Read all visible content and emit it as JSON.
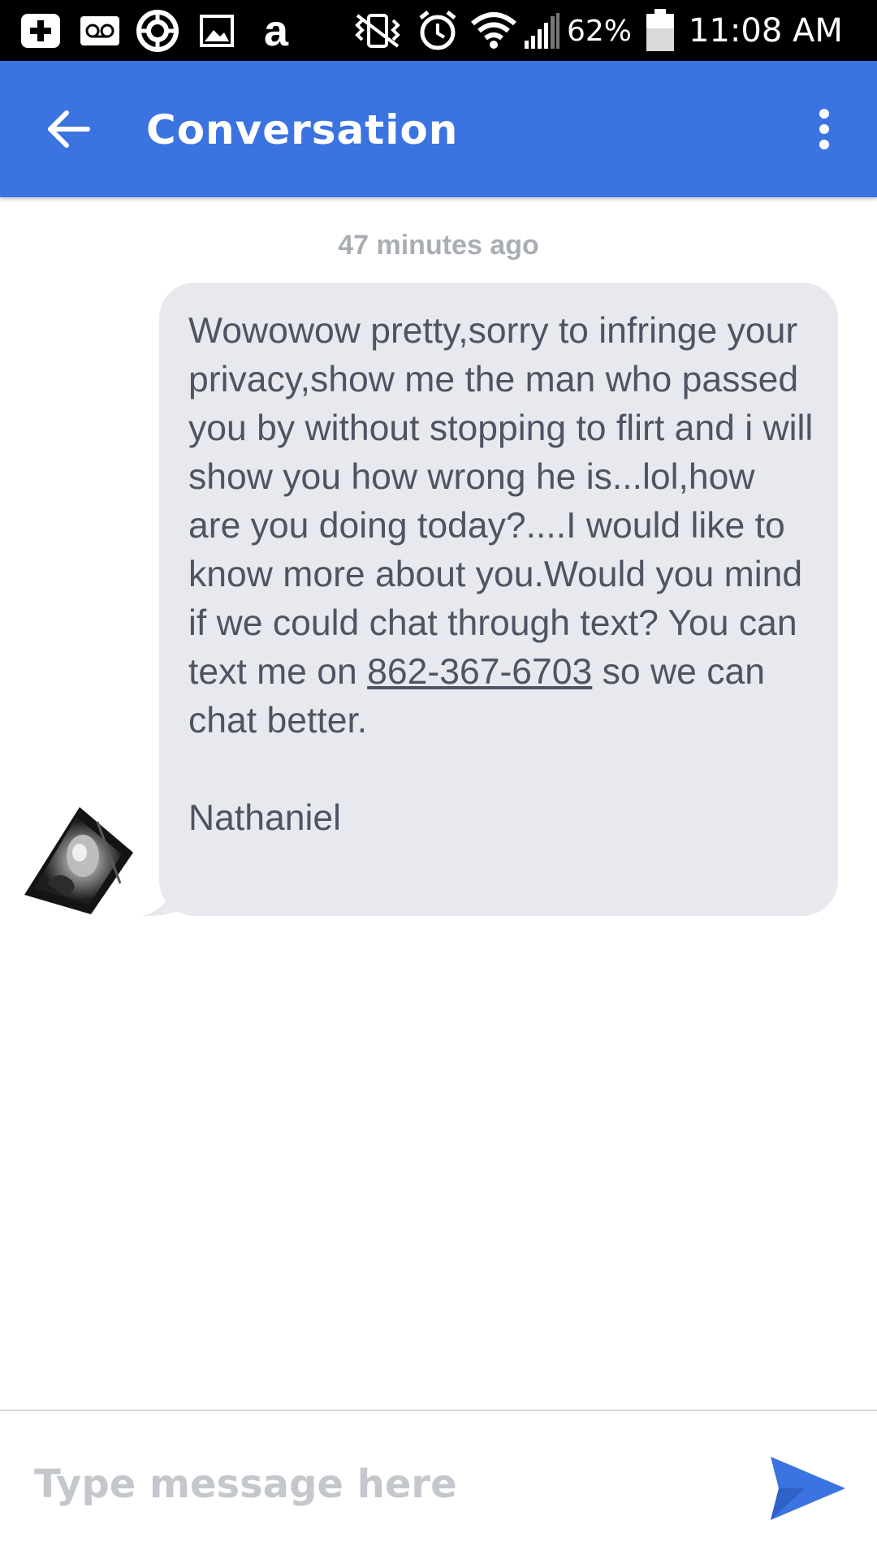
{
  "status_bar": {
    "battery": "62%",
    "time": "11:08 AM",
    "icons": [
      "add-box-icon",
      "voicemail-icon",
      "sync-icon",
      "image-icon",
      "amazon-icon",
      "vibrate-mute-icon",
      "alarm-icon",
      "wifi-icon",
      "signal-icon",
      "battery-icon"
    ],
    "amazon_glyph": "a"
  },
  "app_bar": {
    "title": "Conversation",
    "back_icon": "arrow-back-icon",
    "menu_icon": "more-vert-icon",
    "color": "#3b73e0"
  },
  "conversation": {
    "timestamp": "47 minutes ago",
    "message": {
      "text_before_link": "Wowowow pretty,sorry to infringe your privacy,show me the man who passed you by without stopping to flirt and i will show you how wrong he is...lol,how are you doing today?....I would like to know more about you.Would you mind if we could chat through text? You can text me on ",
      "phone_link": "862-367-6703",
      "text_after_link": " so we can chat better.",
      "signature": "Nathaniel"
    },
    "avatar": "contact-avatar"
  },
  "composer": {
    "placeholder": "Type message here",
    "send_icon": "send-icon",
    "accent": "#3b73e0"
  }
}
